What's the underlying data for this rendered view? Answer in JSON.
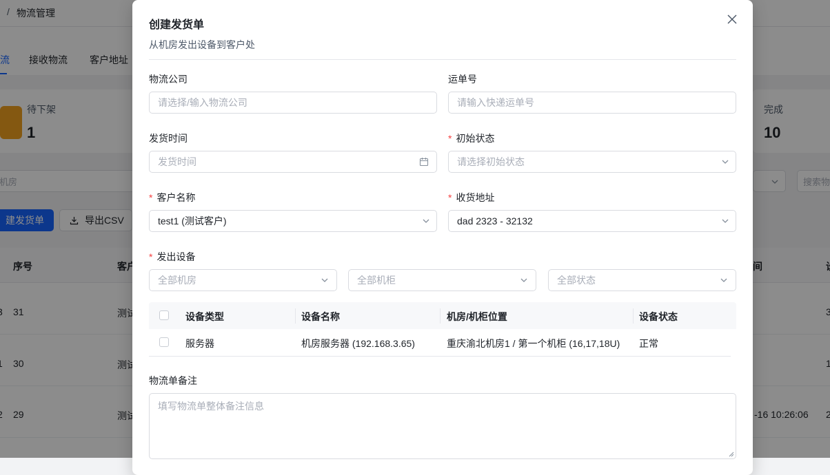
{
  "background": {
    "breadcrumb": "物流管理",
    "breadcrumb_sep": "/",
    "tabs": [
      "流",
      "接收物流",
      "客户地址"
    ],
    "stats": [
      {
        "label": "待下架",
        "value": "1"
      },
      {
        "label": "完成",
        "value": "10"
      }
    ],
    "filter_placeholder_left": "机房",
    "filter_placeholder_right": "搜索物",
    "create_button": "建发货单",
    "export_button": "导出CSV",
    "table_headers": [
      "序号",
      "客户",
      "间",
      "设"
    ],
    "rows": [
      {
        "prefix": "3",
        "id": "31",
        "customer": "测试",
        "time": "",
        "tail": "3"
      },
      {
        "prefix": "1",
        "id": "30",
        "customer": "测试",
        "time": "",
        "tail": "1"
      },
      {
        "prefix": "2",
        "id": "29",
        "customer": "测试",
        "time": "-16 10:26:06",
        "tail": "2"
      }
    ]
  },
  "modal": {
    "title": "创建发货单",
    "subtitle": "从机房发出设备到客户处",
    "fields": {
      "company": {
        "label": "物流公司",
        "placeholder": "请选择/输入物流公司"
      },
      "waybill": {
        "label": "运单号",
        "placeholder": "请输入快递运单号"
      },
      "ship_time": {
        "label": "发货时间",
        "placeholder": "发货时间"
      },
      "init_status": {
        "label": "初始状态",
        "placeholder": "请选择初始状态",
        "required": "*"
      },
      "customer": {
        "label": "客户名称",
        "value": "test1 (测试客户)",
        "required": "*"
      },
      "address": {
        "label": "收货地址",
        "value": "dad 2323 - 32132",
        "required": "*"
      },
      "devices": {
        "label": "发出设备",
        "required": "*"
      }
    },
    "device_filters": [
      "全部机房",
      "全部机柜",
      "全部状态"
    ],
    "device_table": {
      "headers": [
        "设备类型",
        "设备名称",
        "机房/机柜位置",
        "设备状态"
      ],
      "rows": [
        {
          "type": "服务器",
          "name": "机房服务器 (192.168.3.65)",
          "location": "重庆渝北机房1 / 第一个机柜 (16,17,18U)",
          "status": "正常"
        }
      ]
    },
    "remark": {
      "label": "物流单备注",
      "placeholder": "填写物流单整体备注信息"
    }
  }
}
